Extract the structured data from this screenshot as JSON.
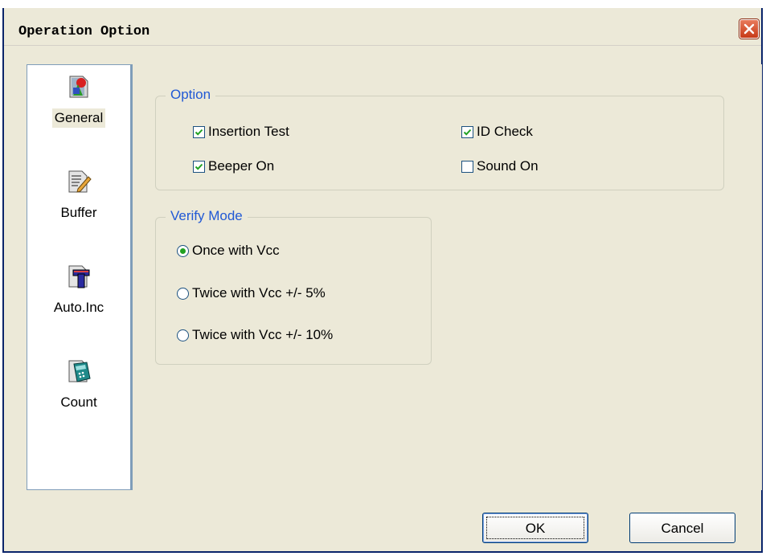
{
  "window": {
    "title": "Operation Option"
  },
  "sidebar": {
    "items": [
      {
        "label": "General",
        "icon": "general-icon",
        "selected": true
      },
      {
        "label": "Buffer",
        "icon": "buffer-pencil-icon",
        "selected": false
      },
      {
        "label": "Auto.Inc",
        "icon": "auto-inc-icon",
        "selected": false
      },
      {
        "label": "Count",
        "icon": "count-calculator-icon",
        "selected": false
      }
    ]
  },
  "option_group": {
    "title": "Option",
    "items": [
      {
        "label": "Insertion Test",
        "checked": true
      },
      {
        "label": "ID Check",
        "checked": true
      },
      {
        "label": "Beeper On",
        "checked": true
      },
      {
        "label": "Sound On",
        "checked": false
      }
    ]
  },
  "verify_group": {
    "title": "Verify Mode",
    "items": [
      {
        "label": "Once with Vcc",
        "selected": true
      },
      {
        "label": "Twice with Vcc +/- 5%",
        "selected": false
      },
      {
        "label": "Twice with Vcc +/- 10%",
        "selected": false
      }
    ]
  },
  "buttons": {
    "ok": "OK",
    "cancel": "Cancel"
  },
  "colors": {
    "group_title": "#2159d5",
    "frame": "#0a246a",
    "close": "#c73a17"
  }
}
